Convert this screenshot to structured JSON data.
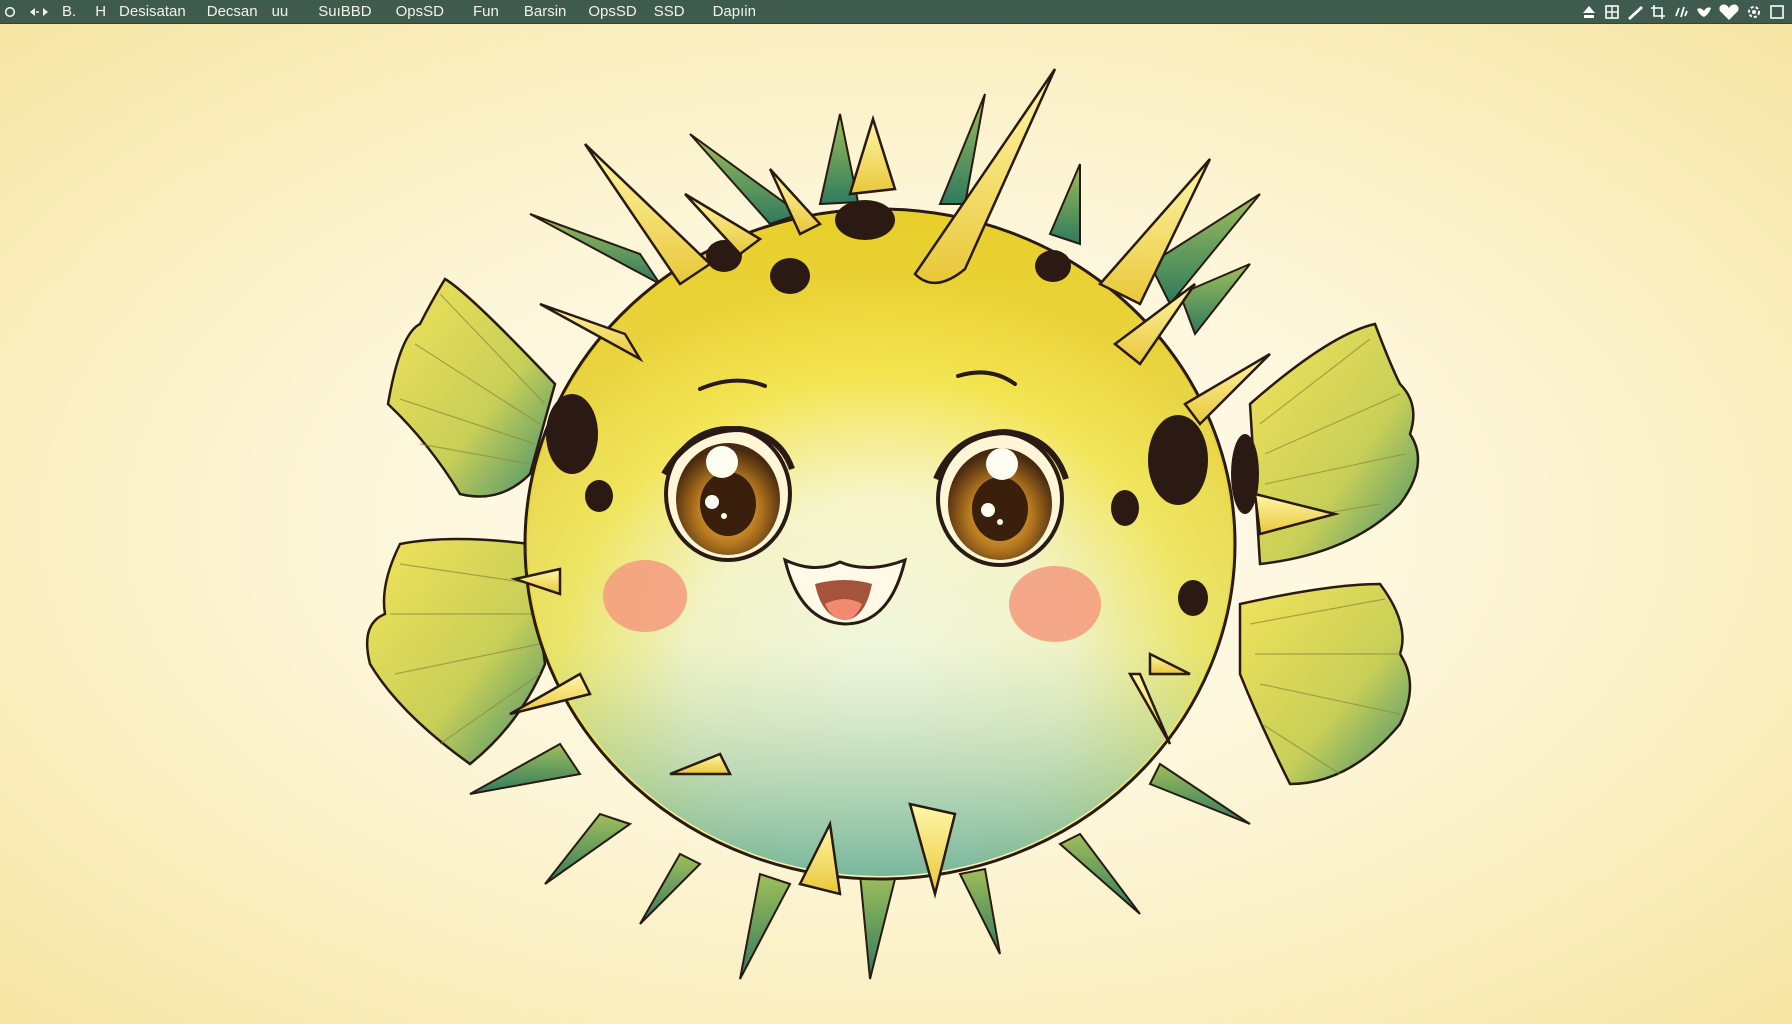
{
  "menubar": {
    "items": [
      "B.",
      "H",
      "Desisatan",
      "Decsan",
      "uu",
      "SuıBBD",
      "OpsSD",
      "Fun",
      "Barsin",
      "OpsSD",
      "SSD",
      "Dapıin"
    ],
    "tray_icons": [
      "eject-icon",
      "window-icon",
      "pen-icon",
      "crop-icon",
      "wifi-icon",
      "bird-icon",
      "heart-icon",
      "settings-icon",
      "square-icon"
    ]
  },
  "illustration": {
    "subject": "pufferfish",
    "colors": {
      "body": "#f6e23a",
      "belly": "#fffbe6",
      "spots": "#2b1a14",
      "spikes": "#f2d64a",
      "fins": "#e9e06a",
      "fin_shadow": "#3f8a6a",
      "cheeks": "#f59a7e",
      "eyes": "#7a4a16",
      "outline": "#2a1a14"
    }
  }
}
